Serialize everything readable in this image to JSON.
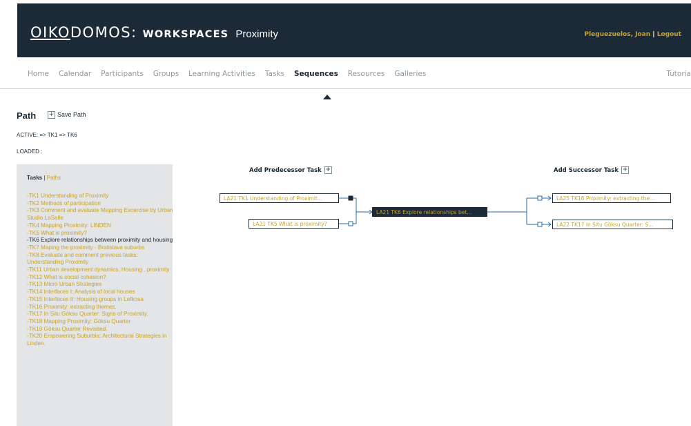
{
  "header": {
    "logo_pre": "OIKO",
    "logo_post": "DOMOS:",
    "logo_ws": "WORKSPACES",
    "context": "Proximity",
    "user": "Pleguezuelos, Joan",
    "logout": "Logout"
  },
  "nav": {
    "items": [
      "Home",
      "Calendar",
      "Participants",
      "Groups",
      "Learning Activities",
      "Tasks",
      "Sequences",
      "Resources",
      "Galleries"
    ],
    "active": "Sequences",
    "right": "Tutoria"
  },
  "path": {
    "title": "Path",
    "save_label": "Save Path",
    "active": "ACTIVE: => TK1 => TK6",
    "loaded": "LOADED :"
  },
  "sidebar": {
    "tab_tasks": "Tasks",
    "sep": "|",
    "tab_paths": "Paths",
    "tasks": [
      "-TK1 Understanding of Proximity",
      "-TK2 Methods of participation",
      "-TK3 Comment and evaluate Mapping Excercise by Urban Studio LaSalle",
      "-TK4 Mapping Proximity: LINDEN",
      "-TK5 What is proximity?",
      "-TK6 Explore relationships between proximity and housing",
      "-TK7 Maping the proximity - Bratislava suburbs",
      "-TK8 Evaluate and comment previous tasks: Understanding Proximity",
      "-TK11 Urban development dynamics, Housing , proximity",
      "-TK12 What is social cohesion?",
      "-TK13 Micro Urban Strategies",
      "-TK14 Interfaces I: Analysis of local houses",
      "-TK15 Interfaces II: Housing groups in Lefkosa",
      "-TK16 Proximity: extracting themes.",
      "-TK17 In Situ Göksu Quarter: Signs of Proximity.",
      "-TK18 Mapping Proximity: Göksu Quarter",
      "-TK19 Göksu Quarter Revisited.",
      "-TK20 Empowering Suburbia: Architectural Strategies in Linden."
    ],
    "current_index": 5
  },
  "diagram": {
    "add_predecessor": "Add Predecessor Task",
    "add_successor": "Add Successor Task",
    "predecessors": [
      "LA21 TK1 Understanding of Proximit...",
      "LA21 TK5 What is proximity?"
    ],
    "center": "LA21 TK6 Explore relationships bet...",
    "successors": [
      "LA25 TK16 Proximity: extracting the...",
      "LA22 TK17 In Situ Göksu Quarter: S..."
    ]
  },
  "colors": {
    "header_bg": "#1b2a36",
    "accent": "#c9a227",
    "sidebar_bg": "#e3e5e7",
    "nav_text": "#8e979d"
  }
}
